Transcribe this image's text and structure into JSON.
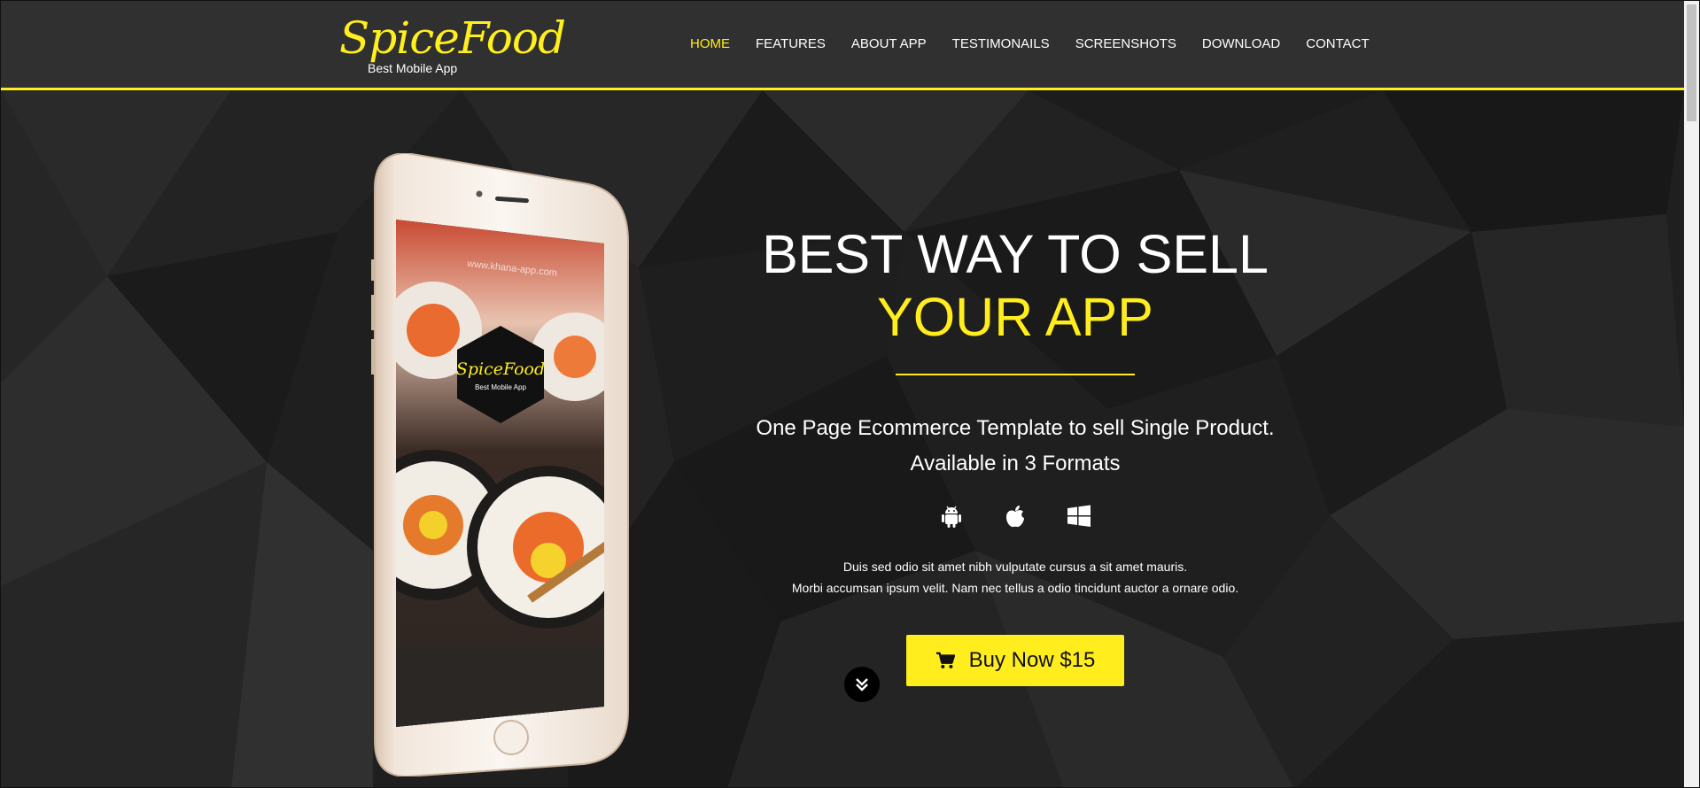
{
  "brand": {
    "name": "SpiceFood",
    "tagline": "Best Mobile App"
  },
  "nav": {
    "items": [
      {
        "label": "HOME",
        "active": true
      },
      {
        "label": "FEATURES"
      },
      {
        "label": "ABOUT APP"
      },
      {
        "label": "TESTIMONAILS"
      },
      {
        "label": "SCREENSHOTS"
      },
      {
        "label": "DOWNLOAD"
      },
      {
        "label": "CONTACT"
      }
    ]
  },
  "hero": {
    "headline_line1": "BEST WAY TO SELL",
    "headline_line2": "YOUR APP",
    "subtitle_line1": "One Page Ecommerce Template to sell Single Product.",
    "subtitle_line2": "Available in 3 Formats",
    "platforms": [
      "android-icon",
      "apple-icon",
      "windows-icon"
    ],
    "desc_line1": "Duis sed odio sit amet nibh vulputate cursus a sit amet mauris.",
    "desc_line2": "Morbi accumsan ipsum velit. Nam nec tellus a odio tincidunt auctor a ornare odio.",
    "buy_label": "Buy Now $15"
  },
  "phone_screen": {
    "url_text": "www.khana-app.com",
    "badge_name": "SpiceFood",
    "badge_tagline": "Best Mobile App"
  },
  "colors": {
    "accent": "#ffed1d",
    "header_bg": "#303030",
    "hero_bg": "#202020"
  }
}
